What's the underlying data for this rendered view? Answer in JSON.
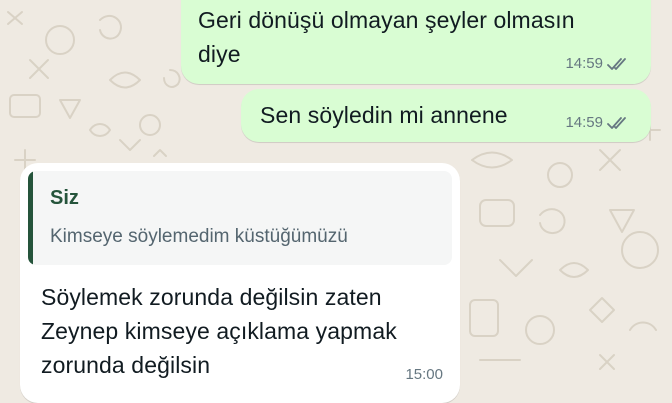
{
  "colors": {
    "chat_background": "#efeae2",
    "outgoing_bubble": "#d9fdd3",
    "incoming_bubble": "#ffffff",
    "quote_accent": "#25543b",
    "meta_text": "#667781"
  },
  "messages": [
    {
      "direction": "outgoing",
      "lines": [
        "Geri dönüşü olmayan şeyler olmasın",
        "diye"
      ],
      "time": "14:59",
      "status_icon": "double-check-icon"
    },
    {
      "direction": "outgoing",
      "lines": [
        "Sen söyledin mi annene"
      ],
      "time": "14:59",
      "status_icon": "double-check-icon"
    },
    {
      "direction": "incoming",
      "quote": {
        "author": "Siz",
        "text": "Kimseye söylemedim küstüğümüzü"
      },
      "lines": [
        "Söylemek zorunda değilsin zaten",
        "Zeynep kimseye açıklama yapmak",
        "zorunda değilsin"
      ],
      "time": "15:00"
    }
  ]
}
